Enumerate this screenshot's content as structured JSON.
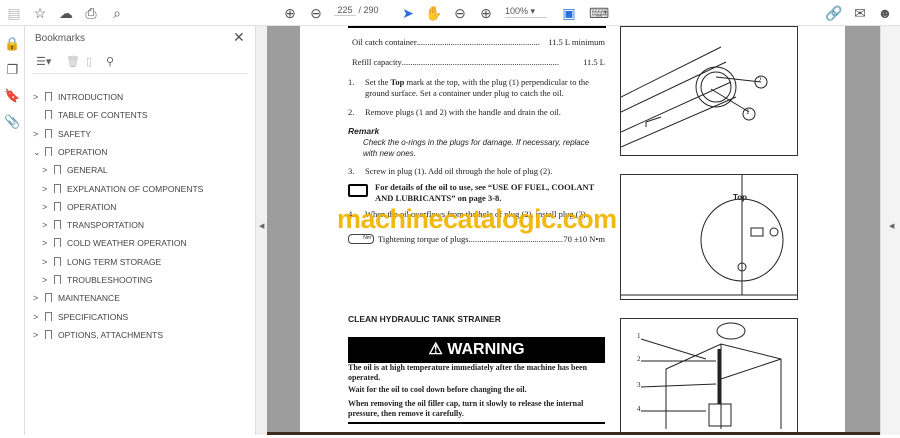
{
  "toolbar": {
    "page_current": "225",
    "page_total": "/ 290",
    "zoom": "100%"
  },
  "bookmarks": {
    "title": "Bookmarks",
    "items": [
      {
        "label": "INTRODUCTION",
        "level": 0,
        "expander": ">"
      },
      {
        "label": "TABLE OF CONTENTS",
        "level": 0,
        "expander": ""
      },
      {
        "label": "SAFETY",
        "level": 0,
        "expander": ">"
      },
      {
        "label": "OPERATION",
        "level": 0,
        "expander": "v"
      },
      {
        "label": "GENERAL",
        "level": 1,
        "expander": ">"
      },
      {
        "label": "EXPLANATION OF COMPONENTS",
        "level": 1,
        "expander": ">"
      },
      {
        "label": "OPERATION",
        "level": 1,
        "expander": ">"
      },
      {
        "label": "TRANSPORTATION",
        "level": 1,
        "expander": ">"
      },
      {
        "label": "COLD WEATHER OPERATION",
        "level": 1,
        "expander": ">"
      },
      {
        "label": "LONG TERM STORAGE",
        "level": 1,
        "expander": ">"
      },
      {
        "label": "TROUBLESHOOTING",
        "level": 1,
        "expander": ">"
      },
      {
        "label": "MAINTENANCE",
        "level": 0,
        "expander": ">"
      },
      {
        "label": "SPECIFICATIONS",
        "level": 0,
        "expander": ">"
      },
      {
        "label": "OPTIONS, ATTACHMENTS",
        "level": 0,
        "expander": ">"
      }
    ]
  },
  "document": {
    "spec1_label": "Oil catch container",
    "spec1_value": "11.5 L minimum",
    "spec2_label": "Refill capacity",
    "spec2_value": "11.5 L",
    "step1_num": "1.",
    "step1_a": "Set the ",
    "step1_bold": "Top",
    "step1_b": " mark at the top, with the plug (1) perpendicular to the ground surface. Set a container under plug to catch the oil.",
    "step2_num": "2.",
    "step2": "Remove plugs (1 and 2) with the handle and drain the oil.",
    "remark_title": "Remark",
    "remark_text": "Check the o-rings in the plugs for damage. If necessary, replace with new ones.",
    "step3_num": "3.",
    "step3": "Screw in plug (1). Add oil through the hole of plug (2).",
    "ref_note": "For details of the oil to use, see “USE OF FUEL, COOLANT AND LUBRICANTS” on page 3-8.",
    "step4_num": "4.",
    "step4": "When the oil overflows from the hole of plug (2), install plug (2).",
    "torque_label": "Tightening torque of plugs",
    "torque_value": "70 ±10 N•m",
    "torque_icon": "Nm",
    "section_title": "CLEAN HYDRAULIC TANK STRAINER",
    "warning_label": "WARNING",
    "warn1": "The oil is at high temperature immediately after the machine has been operated.",
    "warn2": "Wait for the oil to cool down before changing the oil.",
    "warn3": "When removing the oil filler cap, turn it slowly to release the internal pressure, then remove it carefully.",
    "fig2_top": "Top",
    "callouts": [
      "1",
      "2",
      "3",
      "4"
    ],
    "watermark": "machinecatalogic.com"
  }
}
